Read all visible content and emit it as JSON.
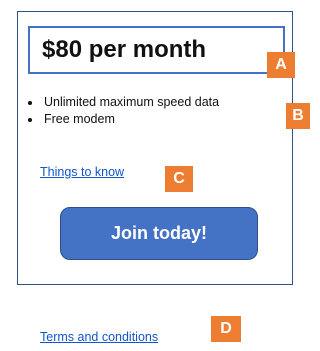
{
  "offer": {
    "price_text": "$80 per month",
    "features": [
      "Unlimited maximum speed data",
      "Free modem"
    ],
    "things_to_know_label": "Things to know",
    "join_button_label": "Join today!"
  },
  "footer": {
    "terms_label": "Terms and conditions"
  },
  "annotations": {
    "a": "A",
    "b": "B",
    "c": "C",
    "d": "D"
  },
  "colors": {
    "brand_blue": "#4472c4",
    "border_navy": "#2f4f86",
    "badge_orange": "#ed7d31",
    "link_blue": "#1155cc"
  }
}
